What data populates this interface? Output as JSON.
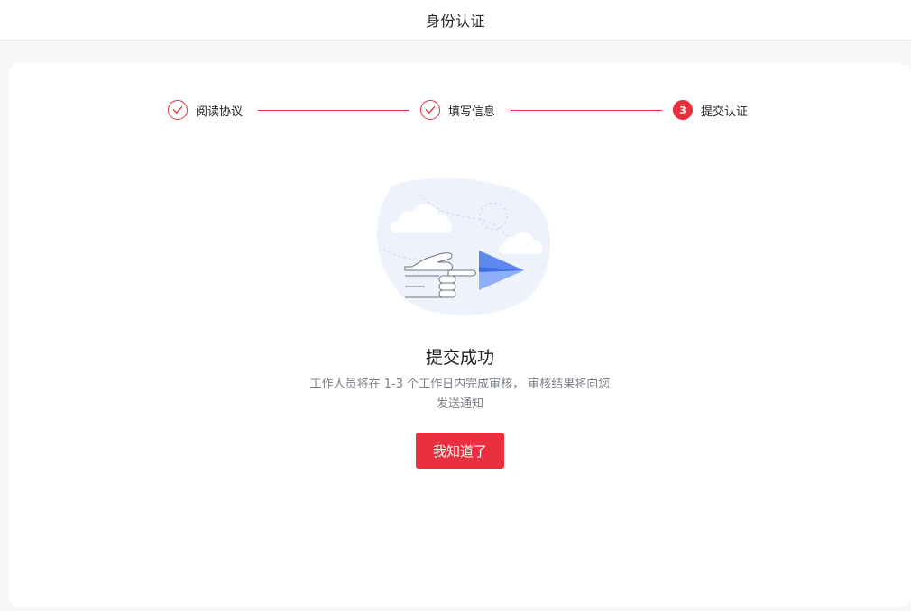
{
  "header": {
    "title": "身份认证"
  },
  "steps": [
    {
      "label": "阅读协议",
      "status": "done",
      "icon": "check-icon"
    },
    {
      "label": "填写信息",
      "status": "done",
      "icon": "check-icon"
    },
    {
      "label": "提交认证",
      "status": "current",
      "number": "3"
    }
  ],
  "result": {
    "title": "提交成功",
    "description_line1": "工作人员将在 1-3 个工作日内完成审核， 审核结果将向您",
    "description_line2": "发送通知",
    "illustration": "paper-plane-hand-illustration"
  },
  "actions": {
    "confirm_label": "我知道了"
  },
  "colors": {
    "accent": "#e5303e",
    "button": "#e9303f",
    "plane": "#6f97f5",
    "blob": "#eef2fd",
    "page_bg": "#f6f7f9"
  }
}
